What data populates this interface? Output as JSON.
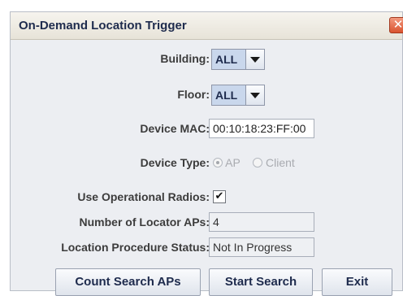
{
  "window": {
    "title": "On-Demand Location Trigger",
    "close_glyph": "✕"
  },
  "form": {
    "building": {
      "label": "Building:",
      "value": "ALL"
    },
    "floor": {
      "label": "Floor:",
      "value": "ALL"
    },
    "device_mac": {
      "label": "Device MAC:",
      "value": "00:10:18:23:FF:00"
    },
    "device_type": {
      "label": "Device Type:",
      "options": [
        "AP",
        "Client"
      ],
      "selected": "AP",
      "enabled": false
    },
    "use_operational_radios": {
      "label": "Use Operational Radios:",
      "checked": true,
      "check_glyph": "✔"
    },
    "number_of_locator_aps": {
      "label": "Number of Locator APs:",
      "value": "4"
    },
    "location_procedure_status": {
      "label": "Location Procedure Status:",
      "value": "Not In Progress"
    }
  },
  "buttons": {
    "count_search_aps": "Count Search APs",
    "start_search": "Start Search",
    "exit": "Exit"
  },
  "colors": {
    "dialog_bg": "#eceef2",
    "title_text": "#1e2b4d",
    "close_button": "#d9532f",
    "combo_bg": "#c9d7ec"
  }
}
